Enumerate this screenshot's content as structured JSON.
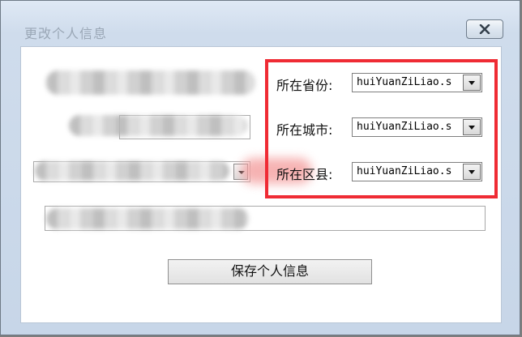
{
  "window": {
    "title": "更改个人信息",
    "close_icon": "close-icon"
  },
  "location": {
    "province_label": "所在省份:",
    "city_label": "所在城市:",
    "county_label": "所在区县:",
    "province_value": "huiYuanZiLiao.s",
    "city_value": "huiYuanZiLiao.s",
    "county_value": "huiYuanZiLiao.s"
  },
  "actions": {
    "save_label": "保存个人信息"
  },
  "colors": {
    "highlight": "#ef2b34",
    "title_text": "#9aa7b6"
  }
}
